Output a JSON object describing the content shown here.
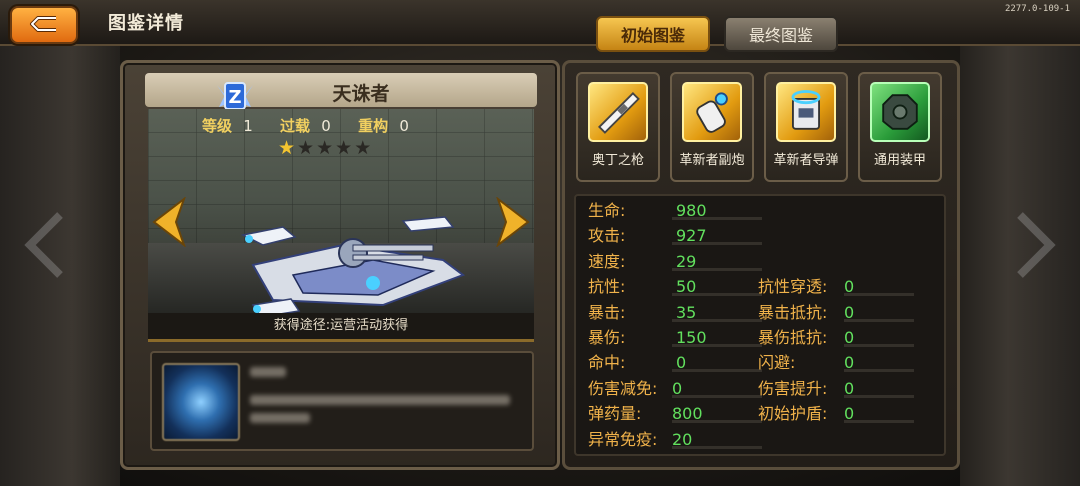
{
  "header": {
    "title": "图鉴详情",
    "version": "2277.0-109-1"
  },
  "tabs": [
    {
      "label": "初始图鉴",
      "active": true
    },
    {
      "label": "最终图鉴",
      "active": false
    }
  ],
  "unit": {
    "name": "天诛者",
    "rank_letter": "Z",
    "level_label": "等级",
    "level": "1",
    "overload_label": "过载",
    "overload": "0",
    "rebuild_label": "重构",
    "rebuild": "0",
    "stars_filled": 1,
    "stars_total": 5,
    "acquisition": "获得途径:运营活动获得"
  },
  "equipment": [
    {
      "label": "奥丁之枪",
      "icon": "gun-icon",
      "quality": "gold"
    },
    {
      "label": "革新者副炮",
      "icon": "cannon-icon",
      "quality": "gold"
    },
    {
      "label": "革新者导弹",
      "icon": "missile-icon",
      "quality": "gold"
    },
    {
      "label": "通用装甲",
      "icon": "armor-icon",
      "quality": "green"
    }
  ],
  "stats": [
    {
      "key": "生命:",
      "value": "980"
    },
    {
      "key": "攻击:",
      "value": "927"
    },
    {
      "key": "速度:",
      "value": "29"
    },
    {
      "key": "抗性:",
      "value": "50"
    },
    {
      "key": "暴击:",
      "value": "35"
    },
    {
      "key": "暴伤:",
      "value": "150"
    },
    {
      "key": "命中:",
      "value": "0"
    },
    {
      "key": "伤害减免:",
      "value": "0"
    },
    {
      "key": "弹药量:",
      "value": "800"
    },
    {
      "key": "异常免疫:",
      "value": "20"
    }
  ],
  "stats_right": [
    {
      "key": "抗性穿透:",
      "value": "0"
    },
    {
      "key": "暴击抵抗:",
      "value": "0"
    },
    {
      "key": "暴伤抵抗:",
      "value": "0"
    },
    {
      "key": "闪避:",
      "value": "0"
    },
    {
      "key": "伤害提升:",
      "value": "0"
    },
    {
      "key": "初始护盾:",
      "value": "0"
    }
  ],
  "colors": {
    "stat_key": "#f0b24a",
    "stat_value": "#62e05e",
    "gold_frame": "#e29b10",
    "green_frame": "#2a9c3a"
  }
}
